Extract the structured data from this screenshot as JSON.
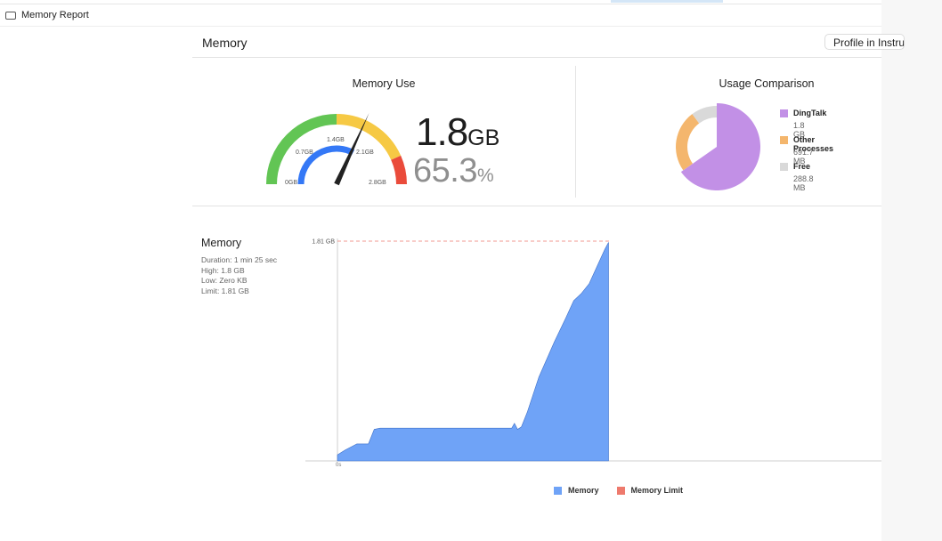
{
  "window": {
    "tab_title": "Memory Report"
  },
  "header": {
    "title": "Memory",
    "profile_button": "Profile in Instruments"
  },
  "memory_use": {
    "title": "Memory Use",
    "value": "1.8",
    "value_unit": "GB",
    "percent": "65.3",
    "percent_unit": "%",
    "gauge_fraction": 0.653,
    "gauge_labels": {
      "l0": "0GB",
      "l1": "0.7GB",
      "l2": "1.4GB",
      "l3": "2.1GB",
      "l4": "2.8GB"
    },
    "colors": {
      "green": "#62c554",
      "yellow": "#f6c944",
      "red": "#ea4b3b",
      "blue": "#3478f6",
      "needle": "#222222"
    }
  },
  "usage_comparison": {
    "title": "Usage Comparison",
    "chart_data": {
      "type": "pie",
      "slices": [
        {
          "name": "DingTalk",
          "value_label": "1.8 GB",
          "value_mb": 1843,
          "color": "#c290e6"
        },
        {
          "name": "Other Processes",
          "value_label": "691.7 MB",
          "value_mb": 691.7,
          "color": "#f4b66d"
        },
        {
          "name": "Free",
          "value_label": "288.8 MB",
          "value_mb": 288.8,
          "color": "#d9d9d9"
        }
      ]
    }
  },
  "memory_graph": {
    "title": "Memory",
    "stats": {
      "duration": "Duration: 1 min 25 sec",
      "high": "High: 1.8 GB",
      "low": "Low: Zero KB",
      "limit": "Limit: 1.81 GB"
    },
    "chart_data": {
      "type": "area",
      "x_unit": "s",
      "x_tick_label": "0s",
      "y_tick_label": "1.81 GB",
      "ylim_gb": [
        0,
        1.81
      ],
      "limit_gb": 1.81,
      "series": [
        {
          "name": "Memory",
          "color": "#6fa3f7",
          "points": [
            [
              0,
              0.05
            ],
            [
              2,
              0.09
            ],
            [
              5,
              0.14
            ],
            [
              8,
              0.14
            ],
            [
              9.5,
              0.26
            ],
            [
              11,
              0.27
            ],
            [
              20,
              0.27
            ],
            [
              30,
              0.27
            ],
            [
              40,
              0.27
            ],
            [
              45,
              0.27
            ],
            [
              45.7,
              0.31
            ],
            [
              46.5,
              0.26
            ],
            [
              47.5,
              0.28
            ],
            [
              49,
              0.4
            ],
            [
              52,
              0.69
            ],
            [
              56,
              0.98
            ],
            [
              59,
              1.18
            ],
            [
              61,
              1.32
            ],
            [
              63,
              1.38
            ],
            [
              65,
              1.46
            ],
            [
              67,
              1.6
            ],
            [
              69,
              1.74
            ],
            [
              70,
              1.8
            ]
          ]
        },
        {
          "name": "Memory Limit",
          "color": "#ee7a6d"
        }
      ]
    },
    "legend": [
      {
        "label": "Memory",
        "color": "#6fa3f7"
      },
      {
        "label": "Memory Limit",
        "color": "#ee7a6d"
      }
    ]
  }
}
